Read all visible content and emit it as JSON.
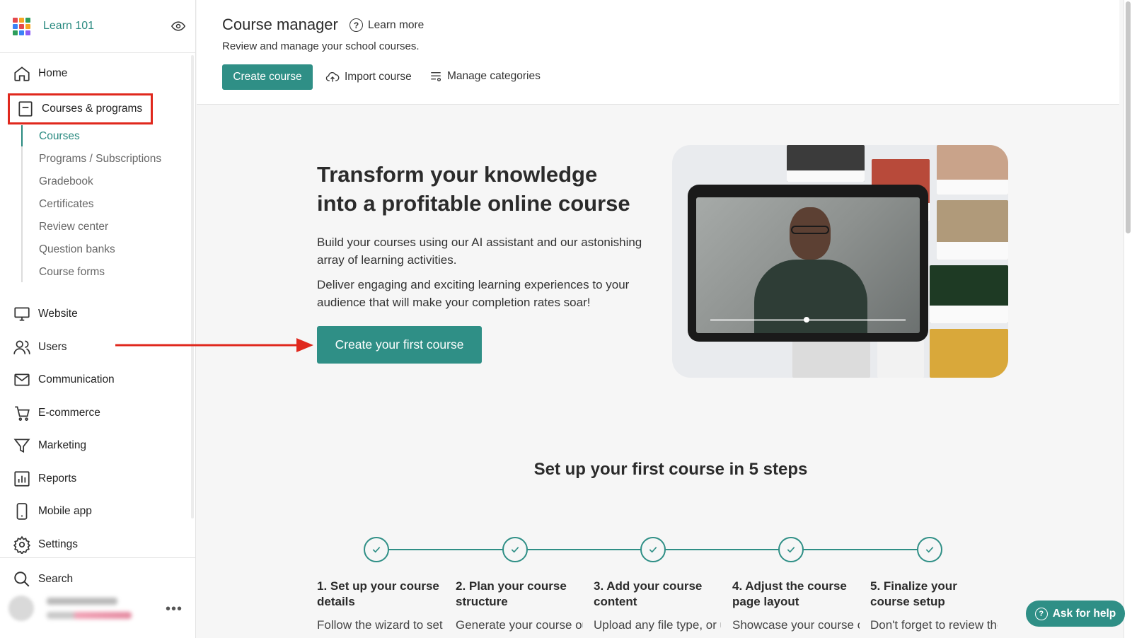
{
  "brand": {
    "name": "Learn 101",
    "grid_colors": [
      "#e5484d",
      "#f5a623",
      "#2e9e5b",
      "#3b82f6",
      "#e5484d",
      "#f5a623",
      "#2e9e5b",
      "#3b82f6",
      "#8b5cf6"
    ]
  },
  "sidebar": {
    "home": "Home",
    "courses_programs": "Courses & programs",
    "sub_items": [
      "Courses",
      "Programs / Subscriptions",
      "Gradebook",
      "Certificates",
      "Review center",
      "Question banks",
      "Course forms"
    ],
    "website": "Website",
    "users": "Users",
    "communication": "Communication",
    "ecommerce": "E-commerce",
    "marketing": "Marketing",
    "reports": "Reports",
    "mobile_app": "Mobile app",
    "settings": "Settings",
    "search": "Search"
  },
  "header": {
    "title": "Course manager",
    "learn_more": "Learn more",
    "subtitle": "Review and manage your school courses.",
    "create_course": "Create course",
    "import_course": "Import course",
    "manage_categories": "Manage categories"
  },
  "hero": {
    "title": "Transform your knowledge into a profitable online course",
    "p1": "Build your courses using our AI assistant and our astonishing array of learning activities.",
    "p2": "Deliver engaging and exciting learning experiences to your audience that will make your completion rates soar!",
    "cta": "Create your first course"
  },
  "steps": {
    "title": "Set up your first course in 5 steps",
    "items": [
      {
        "title": "1. Set up your course details",
        "desc": "Follow the wizard to set up title, URL"
      },
      {
        "title": "2. Plan your course structure",
        "desc": "Generate your course outline in a"
      },
      {
        "title": "3. Add your course content",
        "desc": "Upload any file type, or use our built-in"
      },
      {
        "title": "4. Adjust the course page layout",
        "desc": "Showcase your course offering and"
      },
      {
        "title": "5. Finalize your course setup",
        "desc": "Don't forget to review the course"
      }
    ]
  },
  "help": {
    "label": "Ask for help"
  },
  "colors": {
    "accent": "#2f8f86",
    "highlight": "#e0281d"
  }
}
